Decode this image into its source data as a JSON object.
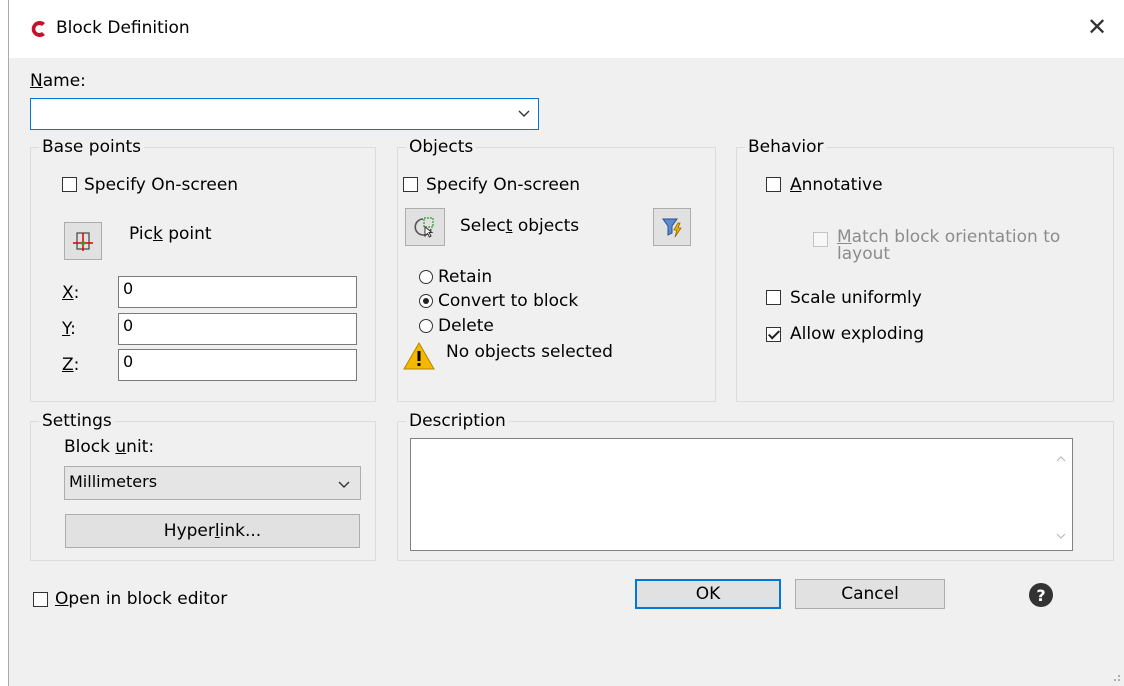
{
  "window": {
    "title": "Block Definition",
    "close_glyph": "✕"
  },
  "name": {
    "label": "Name:",
    "label_key": "N",
    "label_rest": "ame:",
    "value": ""
  },
  "base_points": {
    "legend": "Base points",
    "specify_on_screen": "Specify On-screen",
    "pick_point_pre": "Pic",
    "pick_point_key": "k",
    "pick_point_post": " point",
    "x_key": "X",
    "x_rest": ":",
    "x_value": "0",
    "y_key": "Y",
    "y_rest": ":",
    "y_value": "0",
    "z_key": "Z",
    "z_rest": ":",
    "z_value": "0"
  },
  "objects": {
    "legend": "Objects",
    "specify_on_screen": "Specify On-screen",
    "select_pre": "Selec",
    "select_key": "t",
    "select_post": " objects",
    "retain": "Retain",
    "convert": "Convert to block",
    "delete": "Delete",
    "selected_option": "convert",
    "status": "No objects selected"
  },
  "behavior": {
    "legend": "Behavior",
    "annotative_key": "A",
    "annotative_rest": "nnotative",
    "match_key": "M",
    "match_rest": "atch block orientation to",
    "match_line2": "layout",
    "scale_uniformly": "Scale uniformly",
    "allow_exploding": "Allow exploding",
    "allow_exploding_checked": true
  },
  "settings": {
    "legend": "Settings",
    "block_unit_pre": "Block ",
    "block_unit_key": "u",
    "block_unit_post": "nit:",
    "unit_value": "Millimeters",
    "hyperlink_pre": "Hyper",
    "hyperlink_key": "l",
    "hyperlink_post": "ink..."
  },
  "description": {
    "legend": "Description",
    "value": ""
  },
  "footer": {
    "open_editor_key": "O",
    "open_editor_rest": "pen in block editor",
    "ok": "OK",
    "cancel": "Cancel",
    "help_glyph": "?"
  },
  "colors": {
    "accent": "#0078d7",
    "app_icon": "#c8102e",
    "warning": "#f5b800"
  }
}
